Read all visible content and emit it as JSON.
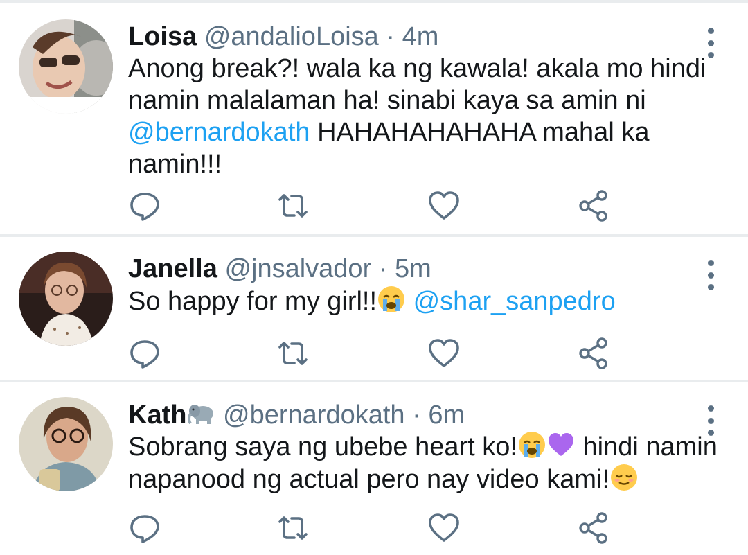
{
  "tweets": [
    {
      "name": "Loisa",
      "handle": "@andalioLoisa",
      "separator": "·",
      "time": "4m",
      "text_line1": "Anong break?! wala ka ng kawala! akala mo hindi",
      "text_line2": "namin malalaman ha! sinabi kaya sa amin ni",
      "text_mention": "@bernardokath",
      "text_line3_rest": " HAHAHAHAHAHA mahal ka",
      "text_line4": "namin!!!"
    },
    {
      "name": "Janella",
      "handle": "@jnsalvador",
      "separator": "·",
      "time": "5m",
      "text_before": "So happy for my girl!!",
      "emoji1": "loudly-crying-face",
      "text_mention": "@shar_sanpedro"
    },
    {
      "name": "Kath",
      "name_emoji": "elephant",
      "handle": "@bernardokath",
      "separator": "·",
      "time": "6m",
      "text_line1_a": "Sobrang saya ng ubebe heart ko!",
      "emoji1": "loudly-crying-face",
      "emoji2": "purple-heart",
      "text_line1_b": " hindi namin",
      "text_line2": "napanood ng actual pero nay video kami!",
      "emoji3": "relieved-face"
    }
  ],
  "actions": [
    "reply-icon",
    "retweet-icon",
    "like-icon",
    "share-icon"
  ],
  "colors": {
    "text": "#14171a",
    "secondary": "#5b7083",
    "link": "#1da1f2",
    "divider": "#e9ecee"
  }
}
